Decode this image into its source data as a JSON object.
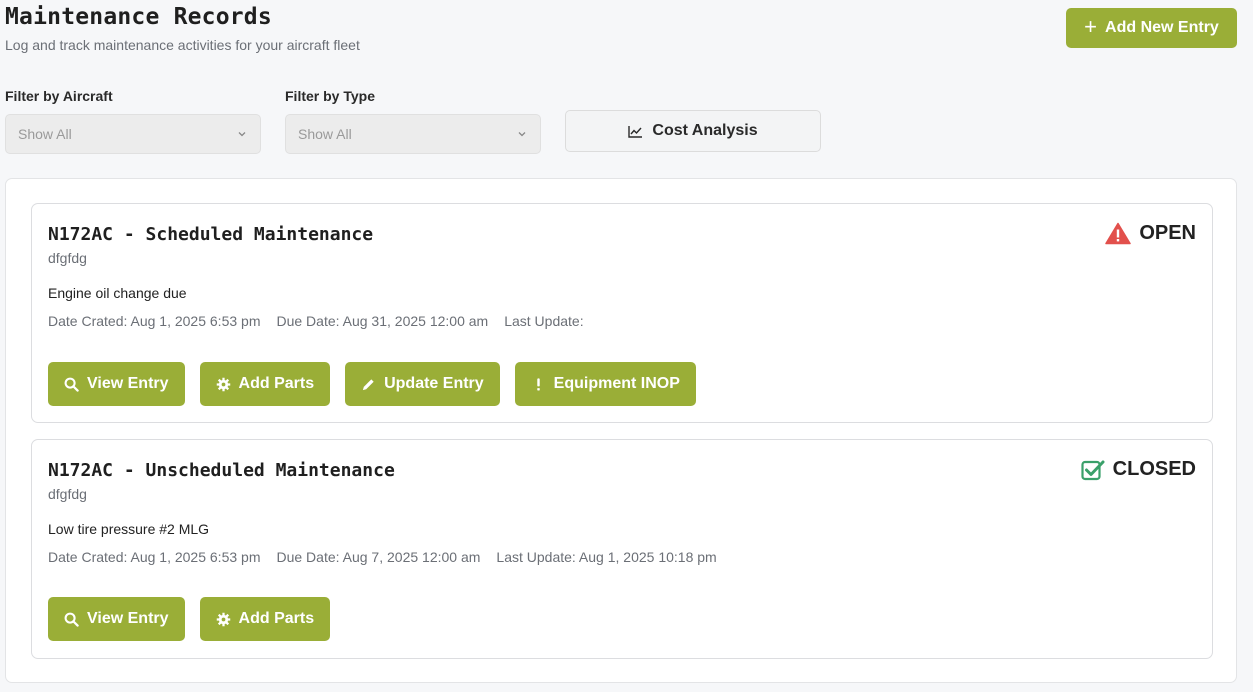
{
  "header": {
    "title": "Maintenance Records",
    "subtitle": "Log and track maintenance activities for your aircraft fleet",
    "add_button": "Add New Entry"
  },
  "filters": {
    "aircraft_label": "Filter by Aircraft",
    "aircraft_value": "Show All",
    "type_label": "Filter by Type",
    "type_value": "Show All",
    "cost_button": "Cost Analysis"
  },
  "colors": {
    "accent": "#9aae37",
    "open_icon": "#e2504c",
    "closed_icon": "#3aa06a"
  },
  "records": [
    {
      "title": "N172AC - Scheduled Maintenance",
      "subtitle": "dfgfdg",
      "description": "Engine oil change due",
      "date_created": "Date Crated: Aug 1, 2025 6:53 pm",
      "due_date": "Due Date: Aug 31, 2025 12:00 am",
      "last_update": "Last Update:",
      "status": "OPEN",
      "status_icon": "warning-triangle-icon",
      "actions": {
        "view": "View Entry",
        "parts": "Add Parts",
        "update": "Update Entry",
        "inop": "Equipment INOP"
      }
    },
    {
      "title": "N172AC - Unscheduled Maintenance",
      "subtitle": "dfgfdg",
      "description": "Low tire pressure #2 MLG",
      "date_created": "Date Crated: Aug 1, 2025 6:53 pm",
      "due_date": "Due Date: Aug 7, 2025 12:00 am",
      "last_update": "Last Update: Aug 1, 2025 10:18 pm",
      "status": "CLOSED",
      "status_icon": "checkbox-check-icon",
      "actions": {
        "view": "View Entry",
        "parts": "Add Parts"
      }
    }
  ]
}
